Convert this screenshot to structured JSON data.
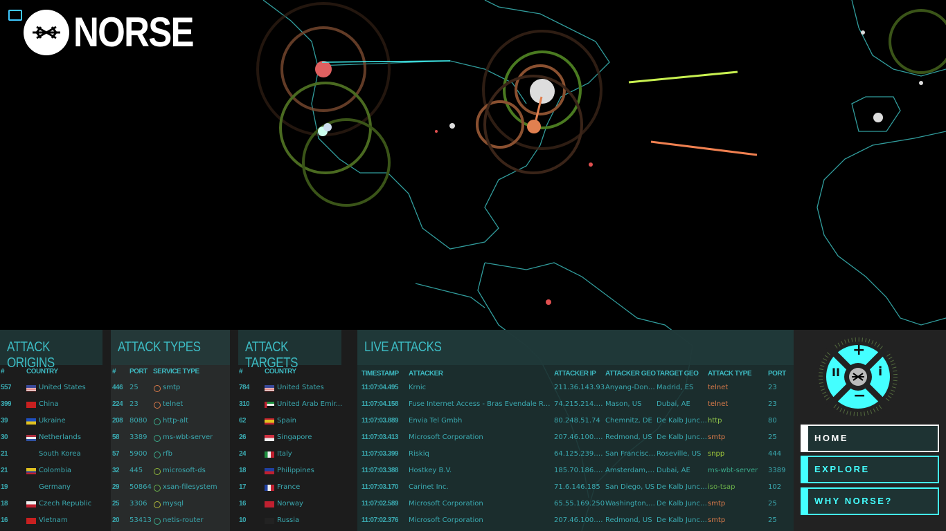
{
  "brand": {
    "name": "NORSE"
  },
  "colors": {
    "accent": "#44ffff",
    "header": "#3dbcc4",
    "orange": "#d97a4a",
    "green": "#8fc34a",
    "teal": "#3aa9b0"
  },
  "origins": {
    "title": "ATTACK ORIGINS",
    "col_num": "#",
    "col_country": "COUNTRY",
    "rows": [
      {
        "n": "557",
        "country": "United States",
        "flag": "us"
      },
      {
        "n": "399",
        "country": "China",
        "flag": "cn"
      },
      {
        "n": "39",
        "country": "Ukraine",
        "flag": "ua"
      },
      {
        "n": "30",
        "country": "Netherlands",
        "flag": "nl"
      },
      {
        "n": "21",
        "country": "South Korea",
        "flag": ""
      },
      {
        "n": "21",
        "country": "Colombia",
        "flag": "co"
      },
      {
        "n": "19",
        "country": "Germany",
        "flag": ""
      },
      {
        "n": "18",
        "country": "Czech Republic",
        "flag": "cz"
      },
      {
        "n": "16",
        "country": "Vietnam",
        "flag": "vn"
      }
    ]
  },
  "types": {
    "title": "ATTACK TYPES",
    "col_num": "#",
    "col_port": "PORT",
    "col_service": "SERVICE TYPE",
    "rows": [
      {
        "n": "446",
        "port": "25",
        "service": "smtp",
        "color": "#d97a4a"
      },
      {
        "n": "224",
        "port": "23",
        "service": "telnet",
        "color": "#d97a4a"
      },
      {
        "n": "208",
        "port": "8080",
        "service": "http-alt",
        "color": "#3aa98a"
      },
      {
        "n": "58",
        "port": "3389",
        "service": "ms-wbt-server",
        "color": "#3aa98a"
      },
      {
        "n": "57",
        "port": "5900",
        "service": "rfb",
        "color": "#3aa98a"
      },
      {
        "n": "32",
        "port": "445",
        "service": "microsoft-ds",
        "color": "#8fb83a"
      },
      {
        "n": "29",
        "port": "50864",
        "service": "xsan-filesystem",
        "color": "#6ab04a"
      },
      {
        "n": "25",
        "port": "3306",
        "service": "mysql",
        "color": "#b0b83a"
      },
      {
        "n": "20",
        "port": "53413",
        "service": "netis-router",
        "color": "#3aa98a"
      }
    ]
  },
  "targets": {
    "title": "ATTACK TARGETS",
    "col_num": "#",
    "col_country": "COUNTRY",
    "rows": [
      {
        "n": "784",
        "country": "United States",
        "flag": "us"
      },
      {
        "n": "310",
        "country": "United Arab Emir...",
        "flag": "ae"
      },
      {
        "n": "62",
        "country": "Spain",
        "flag": "es"
      },
      {
        "n": "26",
        "country": "Singapore",
        "flag": "sg"
      },
      {
        "n": "24",
        "country": "Italy",
        "flag": "it"
      },
      {
        "n": "18",
        "country": "Philippines",
        "flag": "ph"
      },
      {
        "n": "17",
        "country": "France",
        "flag": "fr"
      },
      {
        "n": "16",
        "country": "Norway",
        "flag": "no"
      },
      {
        "n": "10",
        "country": "Russia",
        "flag": "ru"
      }
    ]
  },
  "live": {
    "title": "LIVE ATTACKS",
    "cols": [
      "TIMESTAMP",
      "ATTACKER",
      "ATTACKER IP",
      "ATTACKER GEO",
      "TARGET GEO",
      "ATTACK TYPE",
      "PORT"
    ],
    "rows": [
      {
        "ts": "11:07:04.495",
        "attacker": "Krnic",
        "ip": "211.36.143.93",
        "ageo": "Anyang-Dong, ...",
        "tgeo": "Madrid, ES",
        "type": "telnet",
        "port": "23",
        "color": "#d97a4a"
      },
      {
        "ts": "11:07:04.158",
        "attacker": "Fuse Internet Access - Bras Evendale Regi...",
        "ip": "74.215.214.1...",
        "ageo": "Mason, US",
        "tgeo": "Dubai, AE",
        "type": "telnet",
        "port": "23",
        "color": "#d97a4a"
      },
      {
        "ts": "11:07:03.889",
        "attacker": "Envia Tel Gmbh",
        "ip": "80.248.51.74",
        "ageo": "Chemnitz, DE",
        "tgeo": "De Kalb Junct...",
        "type": "http",
        "port": "80",
        "color": "#8fc34a"
      },
      {
        "ts": "11:07:03.413",
        "attacker": "Microsoft Corporation",
        "ip": "207.46.100.2...",
        "ageo": "Redmond, US",
        "tgeo": "De Kalb Junct...",
        "type": "smtp",
        "port": "25",
        "color": "#d97a4a"
      },
      {
        "ts": "11:07:03.399",
        "attacker": "Riskiq",
        "ip": "64.125.239.1...",
        "ageo": "San Francisco...",
        "tgeo": "Roseville, US",
        "type": "snpp",
        "port": "444",
        "color": "#a0c83a"
      },
      {
        "ts": "11:07:03.388",
        "attacker": "Hostkey B.V.",
        "ip": "185.70.186.1...",
        "ageo": "Amsterdam, NL",
        "tgeo": "Dubai, AE",
        "type": "ms-wbt-server",
        "port": "3389",
        "color": "#3aa98a"
      },
      {
        "ts": "11:07:03.170",
        "attacker": "Carinet Inc.",
        "ip": "71.6.146.185",
        "ageo": "San Diego, US",
        "tgeo": "De Kalb Junct...",
        "type": "iso-tsap",
        "port": "102",
        "color": "#6ab04a"
      },
      {
        "ts": "11:07:02.589",
        "attacker": "Microsoft Corporation",
        "ip": "65.55.169.250",
        "ageo": "Washington, US",
        "tgeo": "De Kalb Junct...",
        "type": "smtp",
        "port": "25",
        "color": "#d97a4a"
      },
      {
        "ts": "11:07:02.376",
        "attacker": "Microsoft Corporation",
        "ip": "207.46.100.2...",
        "ageo": "Redmond, US",
        "tgeo": "De Kalb Junct...",
        "type": "smtp",
        "port": "25",
        "color": "#d97a4a"
      }
    ]
  },
  "nav": {
    "home": "HOME",
    "explore": "EXPLORE",
    "why": "WHY NORSE?"
  },
  "controls": {
    "zoom_in": "+",
    "zoom_out": "−",
    "pause": "II",
    "info": "i"
  }
}
